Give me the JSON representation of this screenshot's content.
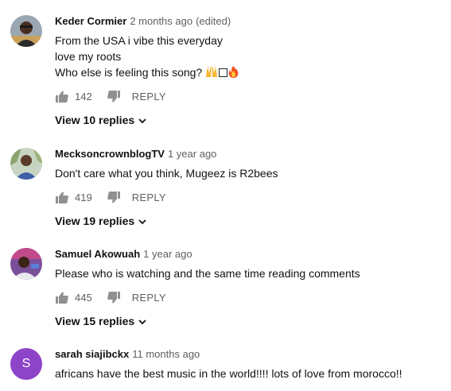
{
  "icons": {
    "like": "thumbs-up-icon",
    "dislike": "thumbs-down-icon",
    "expand": "chevron-down-icon",
    "emoji_praise": "raised-hands-emoji",
    "emoji_missing": "missing-glyph-box",
    "emoji_fire": "fire-emoji"
  },
  "colors": {
    "secondary_text": "#606060",
    "primary_text": "#111111",
    "icon": "#909090",
    "avatar_s_bg": "#8e44c9"
  },
  "comments": [
    {
      "author": "Keder Cormier",
      "time": "2 months ago",
      "edited": "(edited)",
      "lines": [
        "From the USA i vibe this everyday",
        "love my roots",
        "Who else is feeling this song?"
      ],
      "likes": "142",
      "reply_label": "REPLY",
      "view_replies": "View 10 replies"
    },
    {
      "author": "MecksoncrownblogTV",
      "time": "1 year ago",
      "lines": [
        "Don't care what you think, Mugeez is R2bees"
      ],
      "likes": "419",
      "reply_label": "REPLY",
      "view_replies": "View 19 replies"
    },
    {
      "author": "Samuel Akowuah",
      "time": "1 year ago",
      "lines": [
        "Please who is watching and the same time reading comments"
      ],
      "likes": "445",
      "reply_label": "REPLY",
      "view_replies": "View 15 replies"
    },
    {
      "author": "sarah siajibckx",
      "time": "11 months ago",
      "avatar_letter": "S",
      "lines": [
        "africans have the best music in the world!!!! lots of love from morocco!!"
      ]
    }
  ]
}
